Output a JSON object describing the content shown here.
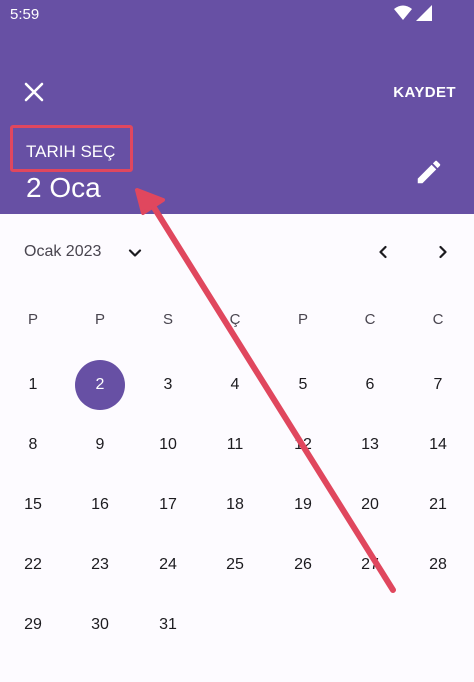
{
  "status_bar": {
    "time": "5:59"
  },
  "header": {
    "save_label": "KAYDET",
    "pick_label": "TARIH SEÇ",
    "selected_date": "2 Oca"
  },
  "calendar": {
    "month_label": "Ocak 2023",
    "weekdays": [
      "P",
      "P",
      "S",
      "Ç",
      "P",
      "C",
      "C"
    ],
    "weeks": [
      [
        "1",
        "2",
        "3",
        "4",
        "5",
        "6",
        "7"
      ],
      [
        "8",
        "9",
        "10",
        "11",
        "12",
        "13",
        "14"
      ],
      [
        "15",
        "16",
        "17",
        "18",
        "19",
        "20",
        "21"
      ],
      [
        "22",
        "23",
        "24",
        "25",
        "26",
        "27",
        "28"
      ],
      [
        "29",
        "30",
        "31",
        "",
        "",
        "",
        ""
      ]
    ],
    "selected_day": "2"
  },
  "colors": {
    "header_bg": "#6750a4",
    "selected_day_bg": "#6750a4",
    "annotation": "#e0475e"
  },
  "icons": [
    "close-icon",
    "edit-pencil-icon",
    "chevron-down-icon",
    "chevron-left-icon",
    "chevron-right-icon",
    "wifi-icon",
    "signal-icon"
  ]
}
